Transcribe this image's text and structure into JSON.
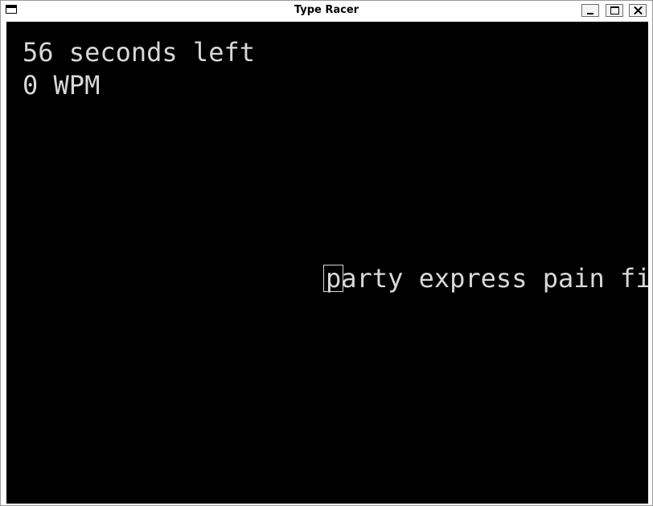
{
  "window": {
    "title": "Type Racer"
  },
  "controls": {
    "menu_icon": "window-menu-icon",
    "minimize_icon": "minimize-icon",
    "maximize_icon": "maximize-icon",
    "close_icon": "close-icon"
  },
  "game": {
    "timer_text": "56 seconds left",
    "wpm_text": "0 WPM",
    "current_char": "p",
    "remaining_text": "arty express pain fi"
  },
  "colors": {
    "background": "#000000",
    "text": "#d8d8d8"
  }
}
